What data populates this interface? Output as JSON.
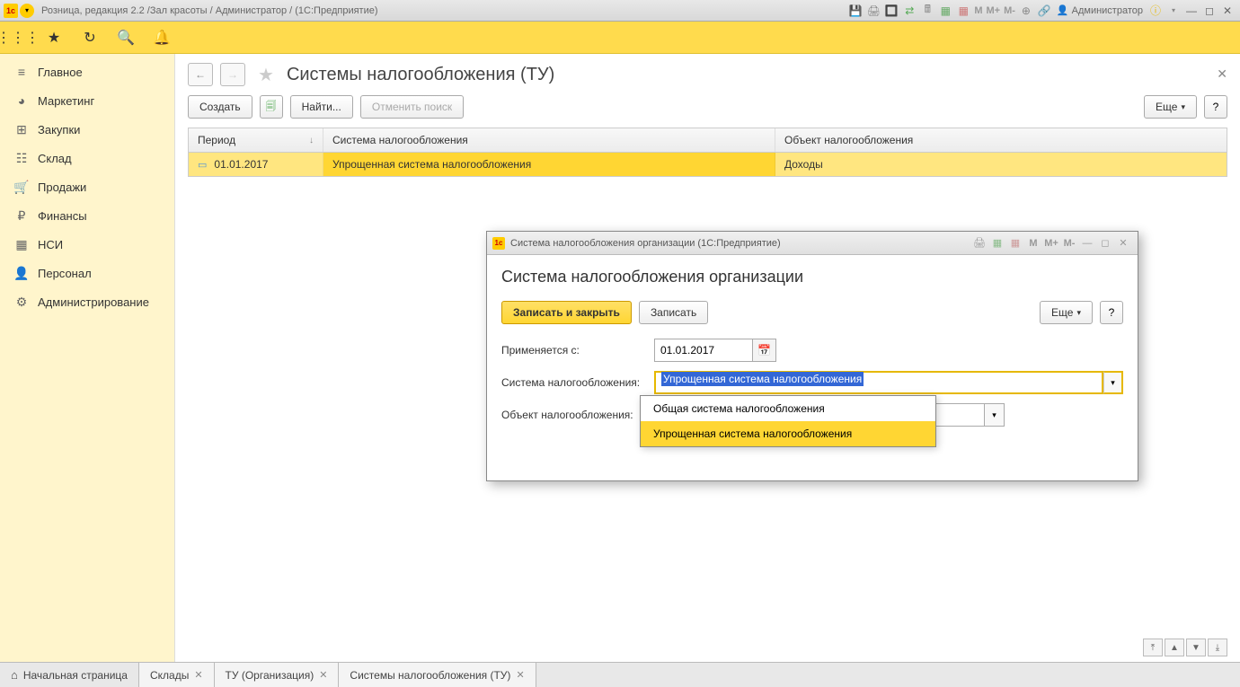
{
  "titlebar": {
    "text": "Розница, редакция 2.2 /Зал красоты / Администратор /  (1С:Предприятие)",
    "m": "M",
    "mplus": "M+",
    "mminus": "M-",
    "user": "Администратор"
  },
  "sidebar": {
    "items": [
      {
        "icon": "≡",
        "label": "Главное"
      },
      {
        "icon": "◕",
        "label": "Маркетинг"
      },
      {
        "icon": "⊞",
        "label": "Закупки"
      },
      {
        "icon": "☷",
        "label": "Склад"
      },
      {
        "icon": "🛒",
        "label": "Продажи"
      },
      {
        "icon": "₽",
        "label": "Финансы"
      },
      {
        "icon": "▦",
        "label": "НСИ"
      },
      {
        "icon": "👤",
        "label": "Персонал"
      },
      {
        "icon": "⚙",
        "label": "Администрирование"
      }
    ]
  },
  "page": {
    "title": "Системы налогообложения (ТУ)",
    "create": "Создать",
    "find": "Найти...",
    "cancelSearch": "Отменить поиск",
    "more": "Еще",
    "help": "?"
  },
  "table": {
    "headers": {
      "period": "Период",
      "system": "Система налогообложения",
      "object": "Объект налогообложения"
    },
    "row": {
      "period": "01.01.2017",
      "system": "Упрощенная система налогообложения",
      "object": "Доходы"
    }
  },
  "dialog": {
    "windowTitle": "Система налогообложения организации  (1С:Предприятие)",
    "heading": "Система налогообложения организации",
    "saveClose": "Записать и закрыть",
    "save": "Записать",
    "more": "Еще",
    "help": "?",
    "labels": {
      "applyFrom": "Применяется с:",
      "taxSystem": "Система налогообложения:",
      "taxObject": "Объект налогообложения:"
    },
    "dateValue": "01.01.2017",
    "systemValue": "Упрощенная система налогообложения",
    "m": "M",
    "mplus": "M+",
    "mminus": "M-",
    "dropdown": {
      "opt1": "Общая система налогообложения",
      "opt2": "Упрощенная система налогообложения"
    }
  },
  "tabs": {
    "home": "Начальная страница",
    "t1": "Склады",
    "t2": "ТУ (Организация)",
    "t3": "Системы налогообложения (ТУ)"
  }
}
